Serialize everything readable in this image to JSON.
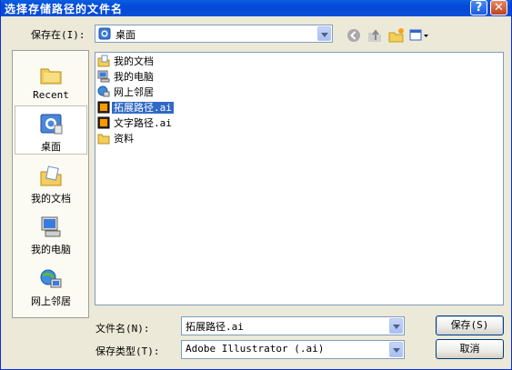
{
  "title": "选择存储路径的文件名",
  "titlebar": {
    "help": "?",
    "close": "✕"
  },
  "save_in": {
    "label": "保存在(I):",
    "value": "桌面"
  },
  "places": [
    {
      "label": "Recent",
      "icon": "recent-folder-icon"
    },
    {
      "label": "桌面",
      "icon": "desktop-icon",
      "active": true
    },
    {
      "label": "我的文档",
      "icon": "my-documents-icon"
    },
    {
      "label": "我的电脑",
      "icon": "my-computer-icon"
    },
    {
      "label": "网上邻居",
      "icon": "network-places-icon"
    }
  ],
  "files": [
    {
      "name": "我的文档",
      "icon": "my-documents-icon"
    },
    {
      "name": "我的电脑",
      "icon": "my-computer-icon"
    },
    {
      "name": "网上邻居",
      "icon": "network-places-icon"
    },
    {
      "name": "拓展路径.ai",
      "icon": "ai-file-icon",
      "selected": true
    },
    {
      "name": "文字路径.ai",
      "icon": "ai-file-icon"
    },
    {
      "name": "资料",
      "icon": "folder-icon"
    }
  ],
  "filename": {
    "label": "文件名(N):",
    "value": "拓展路径.ai"
  },
  "filetype": {
    "label": "保存类型(T):",
    "value": "Adobe Illustrator (.ai)"
  },
  "buttons": {
    "save": "保存(S)",
    "cancel": "取消"
  },
  "colors": {
    "title_bar": "#0348d8",
    "selection": "#316ac5",
    "dialog_bg": "#ece9d8"
  }
}
